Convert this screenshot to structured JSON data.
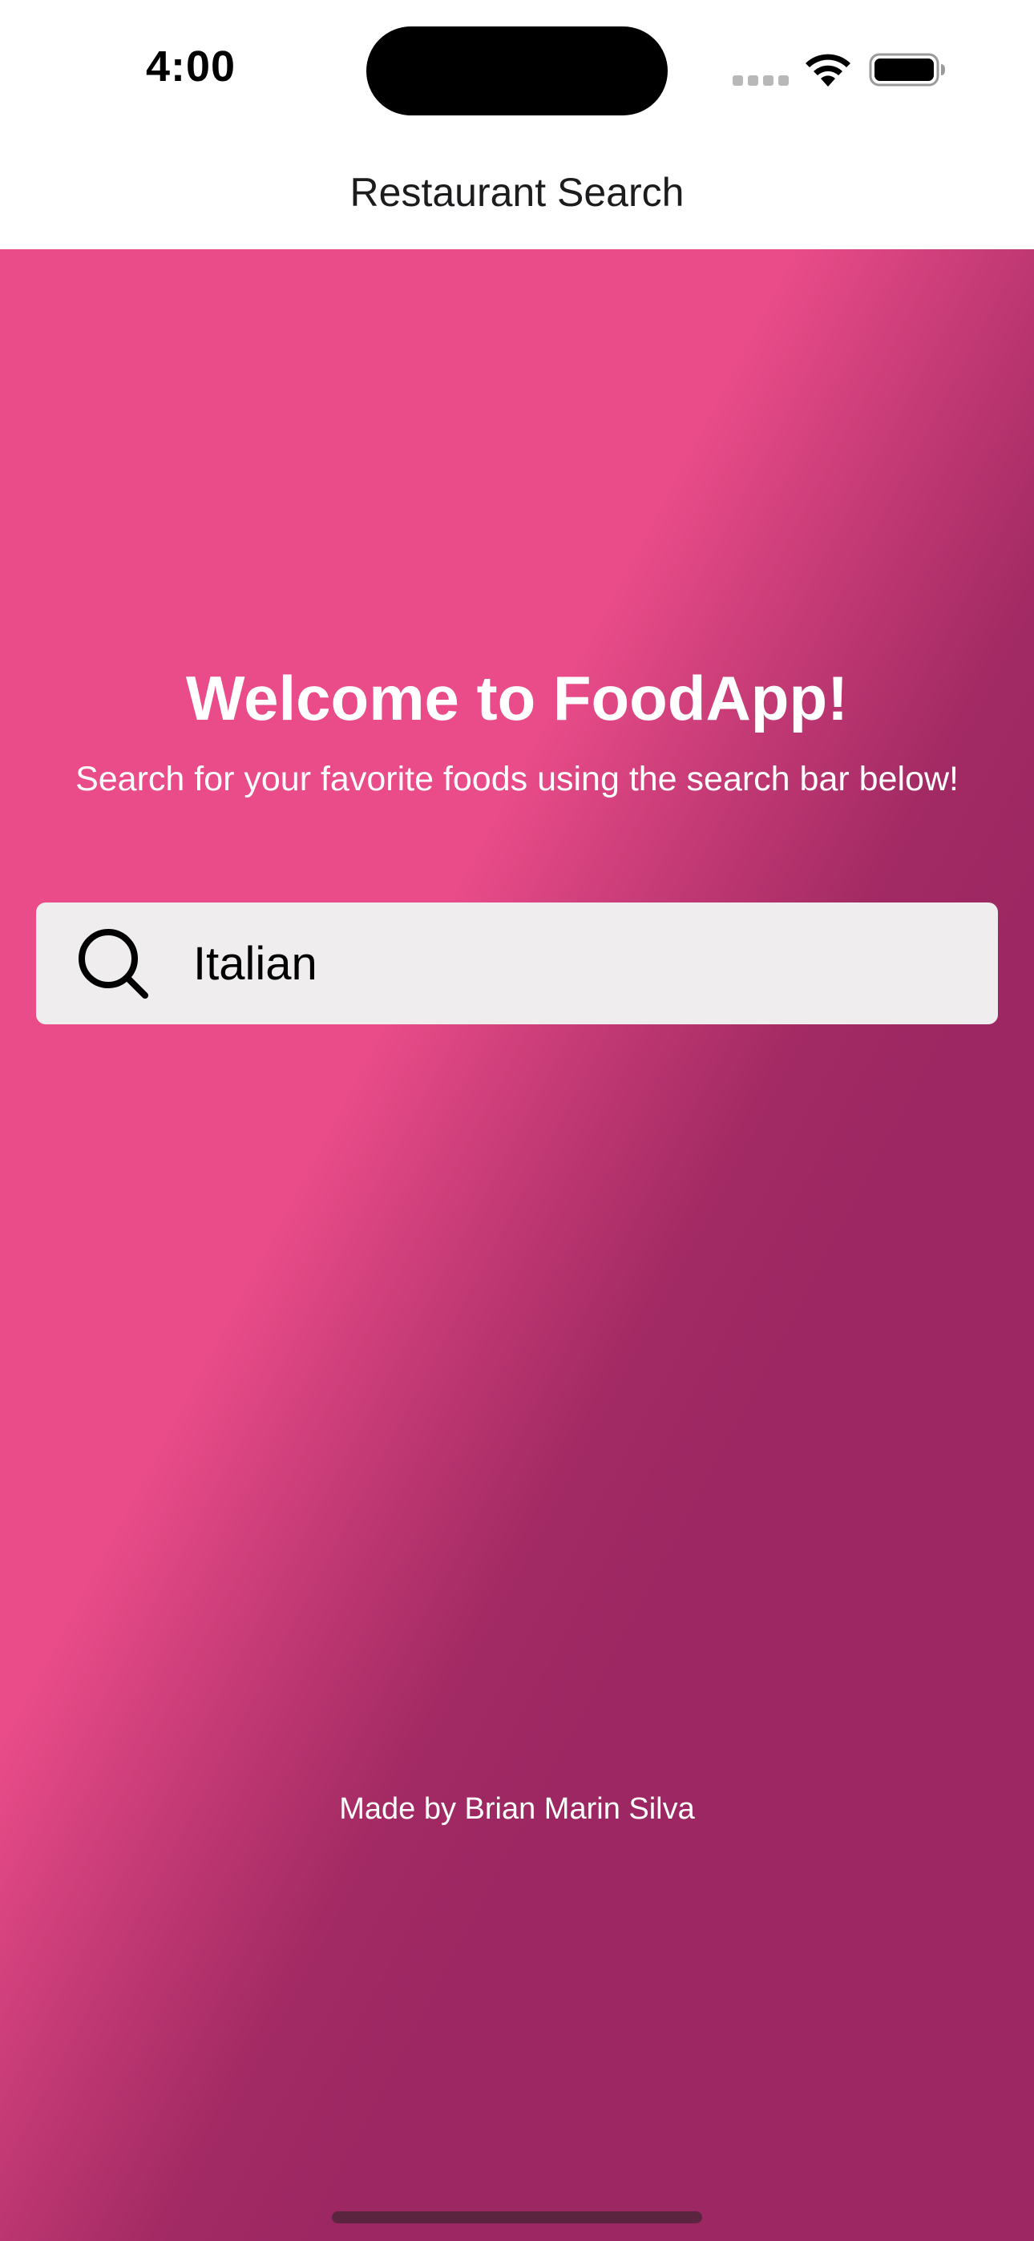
{
  "status_bar": {
    "time": "4:00",
    "icons": [
      "cellular-signal-icon",
      "wifi-icon",
      "battery-icon"
    ]
  },
  "nav": {
    "title": "Restaurant Search"
  },
  "main": {
    "welcome_title": "Welcome to FoodApp!",
    "welcome_subtitle": "Search for your favorite foods using the search bar below!",
    "search": {
      "icon": "search-icon",
      "value": "Italian"
    },
    "footer_credit": "Made by Brian Marin Silva"
  },
  "colors": {
    "gradient_light": "#e94c89",
    "gradient_dark": "#9d2762",
    "search_background": "#efedee",
    "text_on_gradient": "#ffffff"
  }
}
